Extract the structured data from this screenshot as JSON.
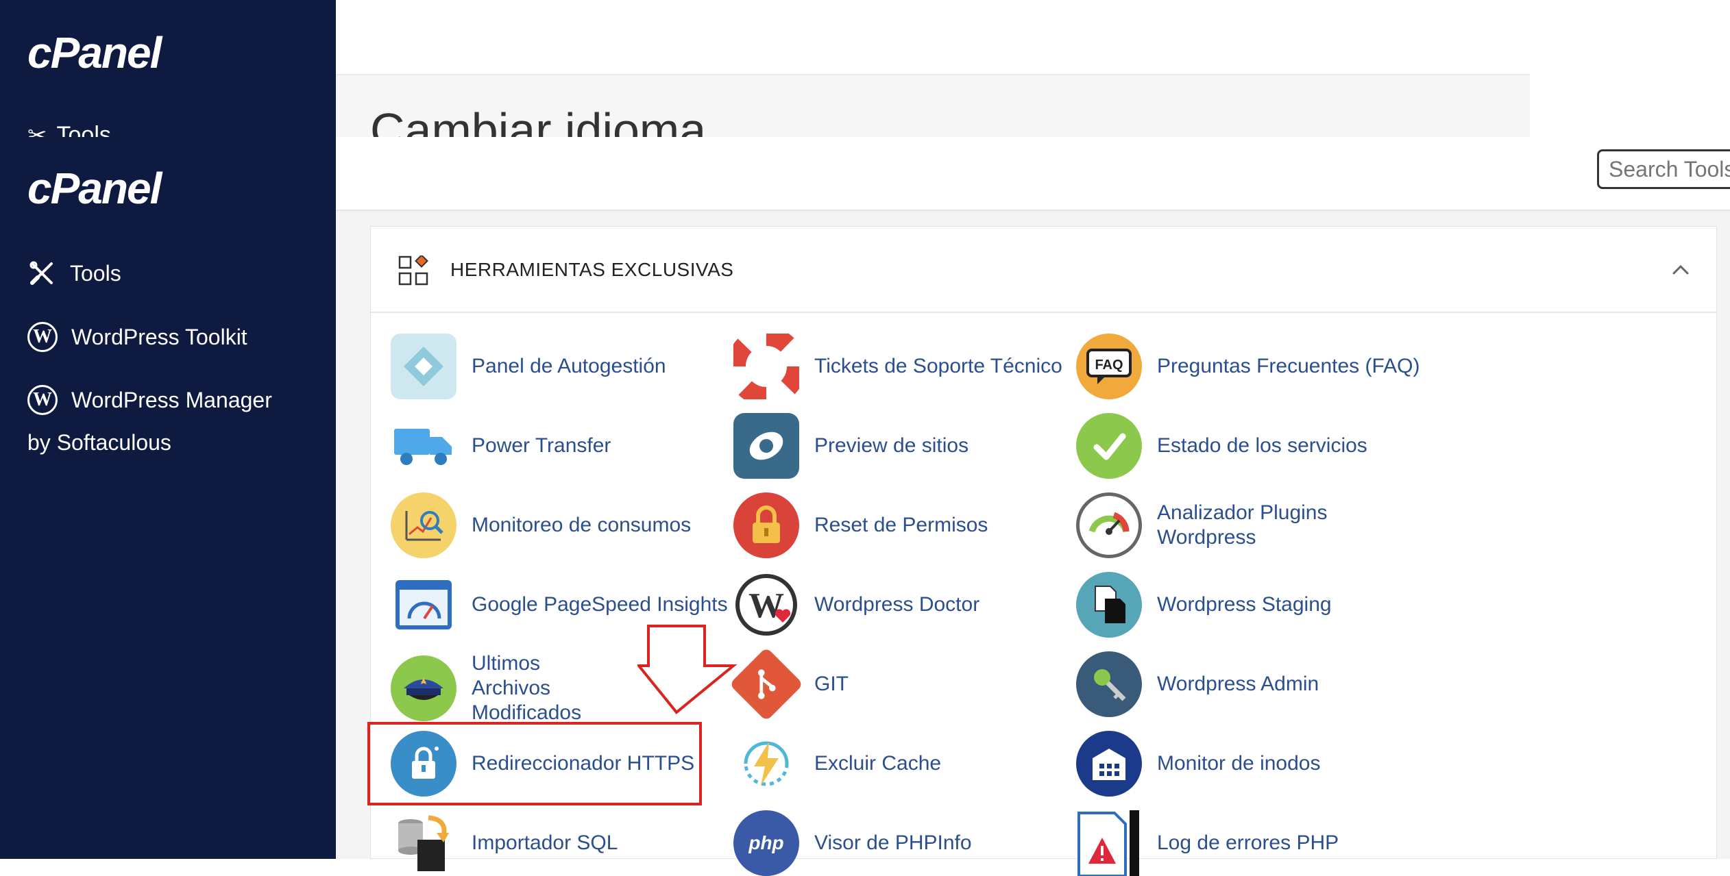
{
  "background": {
    "logo": "cPanel",
    "tools_label": "Tools",
    "page_title": "Cambiar idioma"
  },
  "sidebar": {
    "logo": "cPanel",
    "items": [
      {
        "label": "Tools"
      },
      {
        "label": "WordPress Toolkit"
      },
      {
        "label": "WordPress Manager"
      }
    ],
    "sub_label": "by Softaculous"
  },
  "search": {
    "placeholder": "Search Tools"
  },
  "section": {
    "title": "HERRAMIENTAS EXCLUSIVAS",
    "tools": [
      {
        "label": "Panel de Autogestión",
        "icon": "autogestion-icon"
      },
      {
        "label": "Tickets de Soporte Técnico",
        "icon": "lifebuoy-icon"
      },
      {
        "label": "Preguntas Frecuentes (FAQ)",
        "icon": "faq-icon"
      },
      {
        "label": "Power Transfer",
        "icon": "truck-icon"
      },
      {
        "label": "Preview de sitios",
        "icon": "eye-icon"
      },
      {
        "label": "Estado de los servicios",
        "icon": "checkmark-icon"
      },
      {
        "label": "Monitoreo de consumos",
        "icon": "chart-magnifier-icon"
      },
      {
        "label": "Reset de Permisos",
        "icon": "padlock-icon"
      },
      {
        "label": "Analizador Plugins Wordpress",
        "icon": "gauge-icon"
      },
      {
        "label": "Google PageSpeed Insights",
        "icon": "speedometer-window-icon"
      },
      {
        "label": "Wordpress Doctor",
        "icon": "wordpress-heart-icon"
      },
      {
        "label": "Wordpress Staging",
        "icon": "staging-files-icon"
      },
      {
        "label": "Ultimos Archivos Modificados",
        "icon": "police-cap-icon"
      },
      {
        "label": "GIT",
        "icon": "git-icon"
      },
      {
        "label": "Wordpress Admin",
        "icon": "key-icon"
      },
      {
        "label": "Redireccionador HTTPS",
        "icon": "https-lock-icon"
      },
      {
        "label": "Excluir Cache",
        "icon": "lightning-icon"
      },
      {
        "label": "Monitor de inodos",
        "icon": "inodes-building-icon"
      },
      {
        "label": "Importador SQL",
        "icon": "sql-import-icon"
      },
      {
        "label": "Visor de PHPInfo",
        "icon": "php-icon"
      },
      {
        "label": "Log de errores PHP",
        "icon": "error-log-icon"
      }
    ]
  },
  "colors": {
    "sidebar_bg": "#0e1a40",
    "link": "#2b4f8e",
    "highlight": "#d9241f"
  }
}
